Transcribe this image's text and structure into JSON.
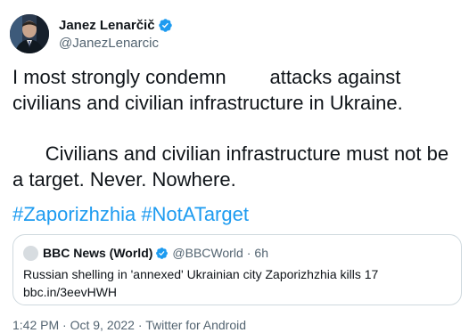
{
  "author": {
    "display_name": "Janez Lenarčič",
    "handle": "@JanezLenarcic",
    "verified_icon": "verified-badge-icon"
  },
  "tweet": {
    "paragraph1": "I most strongly condemn        attacks against civilians and civilian infrastructure in Ukraine.",
    "paragraph2": "      Civilians and civilian infrastructure must not be a target. Never. Nowhere.",
    "hashtags": [
      "#Zaporizhzhia",
      "#NotATarget"
    ]
  },
  "quote": {
    "display_name": "BBC News (World)",
    "handle": "@BBCWorld",
    "separator": "·",
    "time": "6h",
    "text": "Russian shelling in 'annexed' Ukrainian city Zaporizhzhia kills 17",
    "link": "bbc.in/3eevHWH"
  },
  "meta": {
    "time": "1:42 PM",
    "date": "Oct 9, 2022",
    "source": "Twitter for Android",
    "separator": "·"
  },
  "colors": {
    "accent": "#1d9bf0",
    "text": "#0f1419",
    "secondary": "#536471",
    "border": "#cfd9de"
  }
}
